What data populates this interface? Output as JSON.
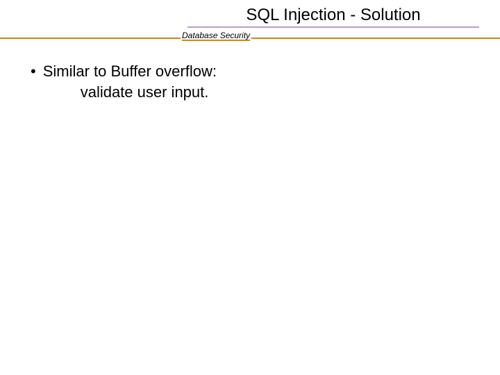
{
  "header": {
    "title": "SQL Injection - Solution",
    "subtitle": "Database Security"
  },
  "content": {
    "bullet_marker": "•",
    "bullet_line1": "Similar to Buffer overflow:",
    "bullet_line2": "validate user input."
  }
}
